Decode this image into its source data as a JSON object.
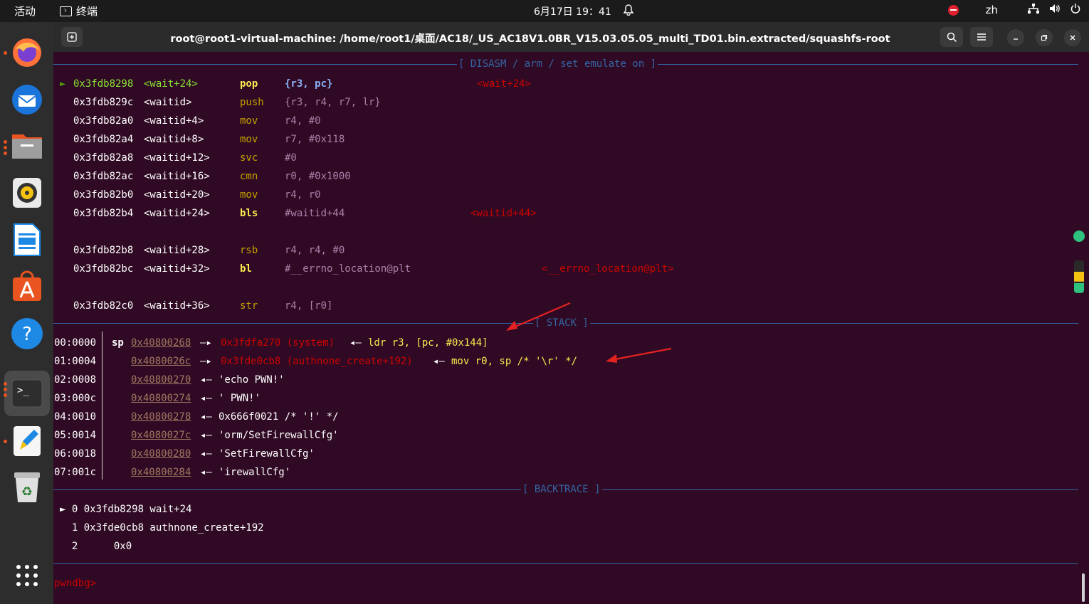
{
  "topbar": {
    "activities": "活动",
    "app_name": "终端",
    "clock": "6月17日  19：41",
    "lang": "zh"
  },
  "dock": {
    "items": [
      "firefox-icon",
      "thunderbird-icon",
      "files-icon",
      "rhythmbox-icon",
      "libreoffice-writer-icon",
      "app-center-icon",
      "help-icon",
      "terminal-icon",
      "text-editor-icon",
      "trash-icon",
      "show-apps-icon"
    ]
  },
  "window": {
    "title": "root@root1-virtual-machine: /home/root1/桌面/AC18/_US_AC18V1.0BR_V15.03.05.05_multi_TD01.bin.extracted/squashfs-root"
  },
  "terminal": {
    "disasm_header": "[ DISASM / arm / set emulate on ]",
    "disasm": [
      {
        "marker": "►",
        "addr": "0x3fdb8298",
        "sym": "<wait+24>",
        "op": "pop",
        "args": "{r3, pc}",
        "comment": "<wait+24>"
      },
      {
        "marker": "",
        "addr": "0x3fdb829c",
        "sym": "<waitid>",
        "op": "push",
        "args": "{r3, r4, r7, lr}",
        "comment": ""
      },
      {
        "marker": "",
        "addr": "0x3fdb82a0",
        "sym": "<waitid+4>",
        "op": "mov",
        "args": "r4, #0",
        "comment": ""
      },
      {
        "marker": "",
        "addr": "0x3fdb82a4",
        "sym": "<waitid+8>",
        "op": "mov",
        "args": "r7, #0x118",
        "comment": ""
      },
      {
        "marker": "",
        "addr": "0x3fdb82a8",
        "sym": "<waitid+12>",
        "op": "svc",
        "args": "#0",
        "comment": ""
      },
      {
        "marker": "",
        "addr": "0x3fdb82ac",
        "sym": "<waitid+16>",
        "op": "cmn",
        "args": "r0, #0x1000",
        "comment": ""
      },
      {
        "marker": "",
        "addr": "0x3fdb82b0",
        "sym": "<waitid+20>",
        "op": "mov",
        "args": "r4, r0",
        "comment": ""
      },
      {
        "marker": "",
        "addr": "0x3fdb82b4",
        "sym": "<waitid+24>",
        "op": "bls",
        "args": "#waitid+44",
        "comment": "<waitid+44>"
      },
      {
        "marker": "",
        "addr": "0x3fdb82b8",
        "sym": "<waitid+28>",
        "op": "rsb",
        "args": "r4, r4, #0",
        "comment": ""
      },
      {
        "marker": "",
        "addr": "0x3fdb82bc",
        "sym": "<waitid+32>",
        "op": "bl",
        "args": "#__errno_location@plt",
        "comment": "<__errno_location@plt>"
      },
      {
        "marker": "",
        "addr": "0x3fdb82c0",
        "sym": "<waitid+36>",
        "op": "str",
        "args": "r4, [r0]",
        "comment": ""
      }
    ],
    "stack_header": "[ STACK ]",
    "stack": [
      {
        "idx": "00:0000",
        "reg": "sp",
        "addr": "0x40800268",
        "arrow": "—▸",
        "target": "0x3fdfa270 (system)",
        "arrow2": "◂—",
        "rest": "ldr r3, [pc, #0x144]"
      },
      {
        "idx": "01:0004",
        "reg": "",
        "addr": "0x4080026c",
        "arrow": "—▸",
        "target": "0x3fde0cb8 (authnone_create+192)",
        "arrow2": "◂—",
        "rest": "mov r0, sp /* '\\r' */"
      },
      {
        "idx": "02:0008",
        "reg": "",
        "addr": "0x40800270",
        "arrow": "",
        "target": "",
        "arrow2": "◂—",
        "rest": "'echo PWN!'"
      },
      {
        "idx": "03:000c",
        "reg": "",
        "addr": "0x40800274",
        "arrow": "",
        "target": "",
        "arrow2": "◂—",
        "rest": "' PWN!'"
      },
      {
        "idx": "04:0010",
        "reg": "",
        "addr": "0x40800278",
        "arrow": "",
        "target": "",
        "arrow2": "◂—",
        "rest": "0x666f0021 /* '!' */"
      },
      {
        "idx": "05:0014",
        "reg": "",
        "addr": "0x4080027c",
        "arrow": "",
        "target": "",
        "arrow2": "◂—",
        "rest": "'orm/SetFirewallCfg'"
      },
      {
        "idx": "06:0018",
        "reg": "",
        "addr": "0x40800280",
        "arrow": "",
        "target": "",
        "arrow2": "◂—",
        "rest": "'SetFirewallCfg'"
      },
      {
        "idx": "07:001c",
        "reg": "",
        "addr": "0x40800284",
        "arrow": "",
        "target": "",
        "arrow2": "◂—",
        "rest": "'irewallCfg'"
      }
    ],
    "backtrace_header": "[ BACKTRACE ]",
    "backtrace": [
      {
        "text": "► 0 0x3fdb8298 wait+24"
      },
      {
        "text": "  1 0x3fde0cb8 authnone_create+192"
      },
      {
        "text": "  2      0x0"
      }
    ],
    "prompt": "pwndbg>"
  }
}
